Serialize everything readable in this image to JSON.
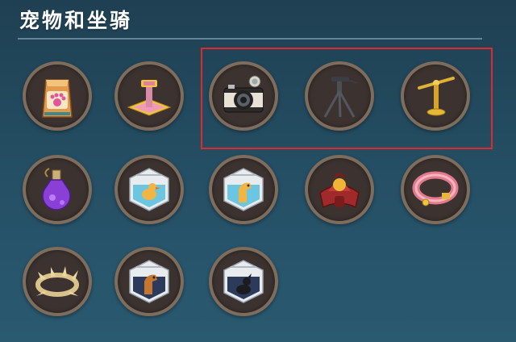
{
  "section": {
    "title": "宠物和坐骑"
  },
  "items": [
    {
      "icon": "pet-food-bag-icon"
    },
    {
      "icon": "cat-scratching-post-icon"
    },
    {
      "icon": "camera-icon"
    },
    {
      "icon": "tripod-icon"
    },
    {
      "icon": "golden-perch-stand-icon"
    },
    {
      "icon": "purple-potion-flask-icon"
    },
    {
      "icon": "duck-pet-carrier-icon"
    },
    {
      "icon": "horse-pet-carrier-icon"
    },
    {
      "icon": "red-saddle-icon"
    },
    {
      "icon": "pink-pet-collar-icon"
    },
    {
      "icon": "thorn-crown-icon"
    },
    {
      "icon": "brown-horse-carrier-icon"
    },
    {
      "icon": "black-dog-carrier-icon"
    }
  ],
  "highlight_color": "#e0292b"
}
